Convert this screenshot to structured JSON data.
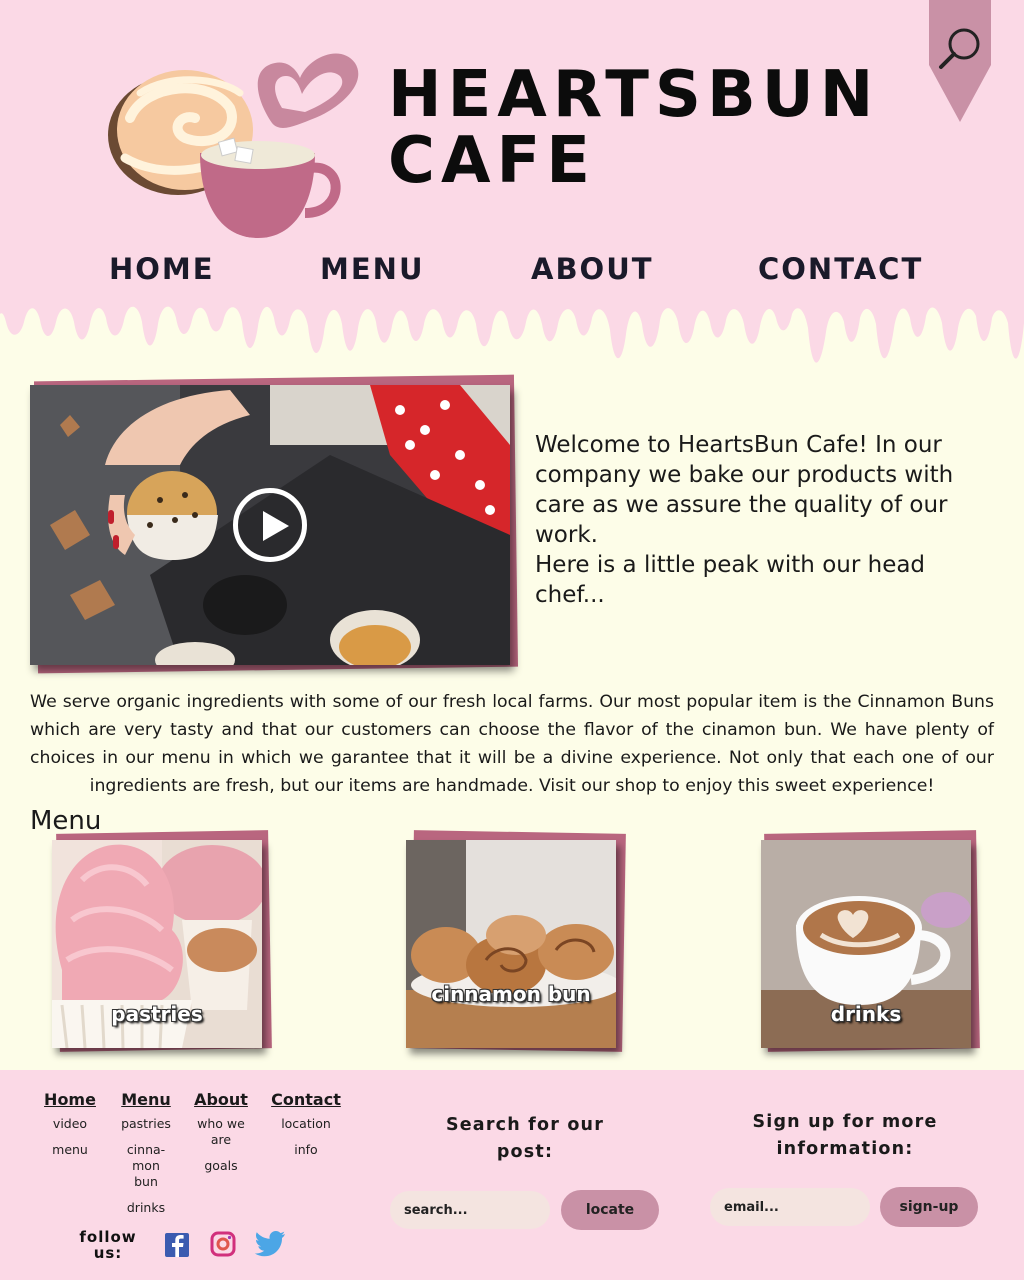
{
  "brand": {
    "line1": "HEARTSBUN",
    "line2": "CAFE"
  },
  "nav": {
    "home": "HOME",
    "menu": "MENU",
    "about": "ABOUT",
    "contact": "CONTACT"
  },
  "welcome": {
    "line1": "Welcome to HeartsBun Cafe! In our company we bake our products with care as we assure the quality of our work.",
    "line2": "Here is a little peak with our head chef..."
  },
  "about_text": "We serve organic ingredients with some of our fresh local farms. Our most popular item is the Cinnamon Buns which are very tasty and that our customers can choose the flavor of the cinamon bun. We have plenty of choices in our menu in which we garantee that it will be a divine experience. Not only that each one of our ingredients are fresh, but our items are handmade. Visit our shop to enjoy this sweet experience!",
  "menu": {
    "title": "Menu",
    "cards": [
      {
        "label": "pastries"
      },
      {
        "label": "cinnamon bun"
      },
      {
        "label": "drinks"
      }
    ]
  },
  "footer": {
    "cols": [
      {
        "head": "Home",
        "items": [
          "video",
          "menu"
        ]
      },
      {
        "head": "Menu",
        "items": [
          "pastries",
          "cinna-mon bun",
          "drinks"
        ]
      },
      {
        "head": "About",
        "items": [
          "who we are",
          "goals"
        ]
      },
      {
        "head": "Contact",
        "items": [
          "location",
          "info"
        ]
      }
    ],
    "follow": "follow us:",
    "search_title": "Search for our post:",
    "search_placeholder": "search...",
    "search_button": "locate",
    "signup_title": "Sign up for more information:",
    "email_placeholder": "email...",
    "signup_button": "sign-up"
  },
  "colors": {
    "header_pink": "#fbd9e6",
    "cream": "#fdfde8",
    "mauve": "#b9667f",
    "button": "#c991a6"
  }
}
